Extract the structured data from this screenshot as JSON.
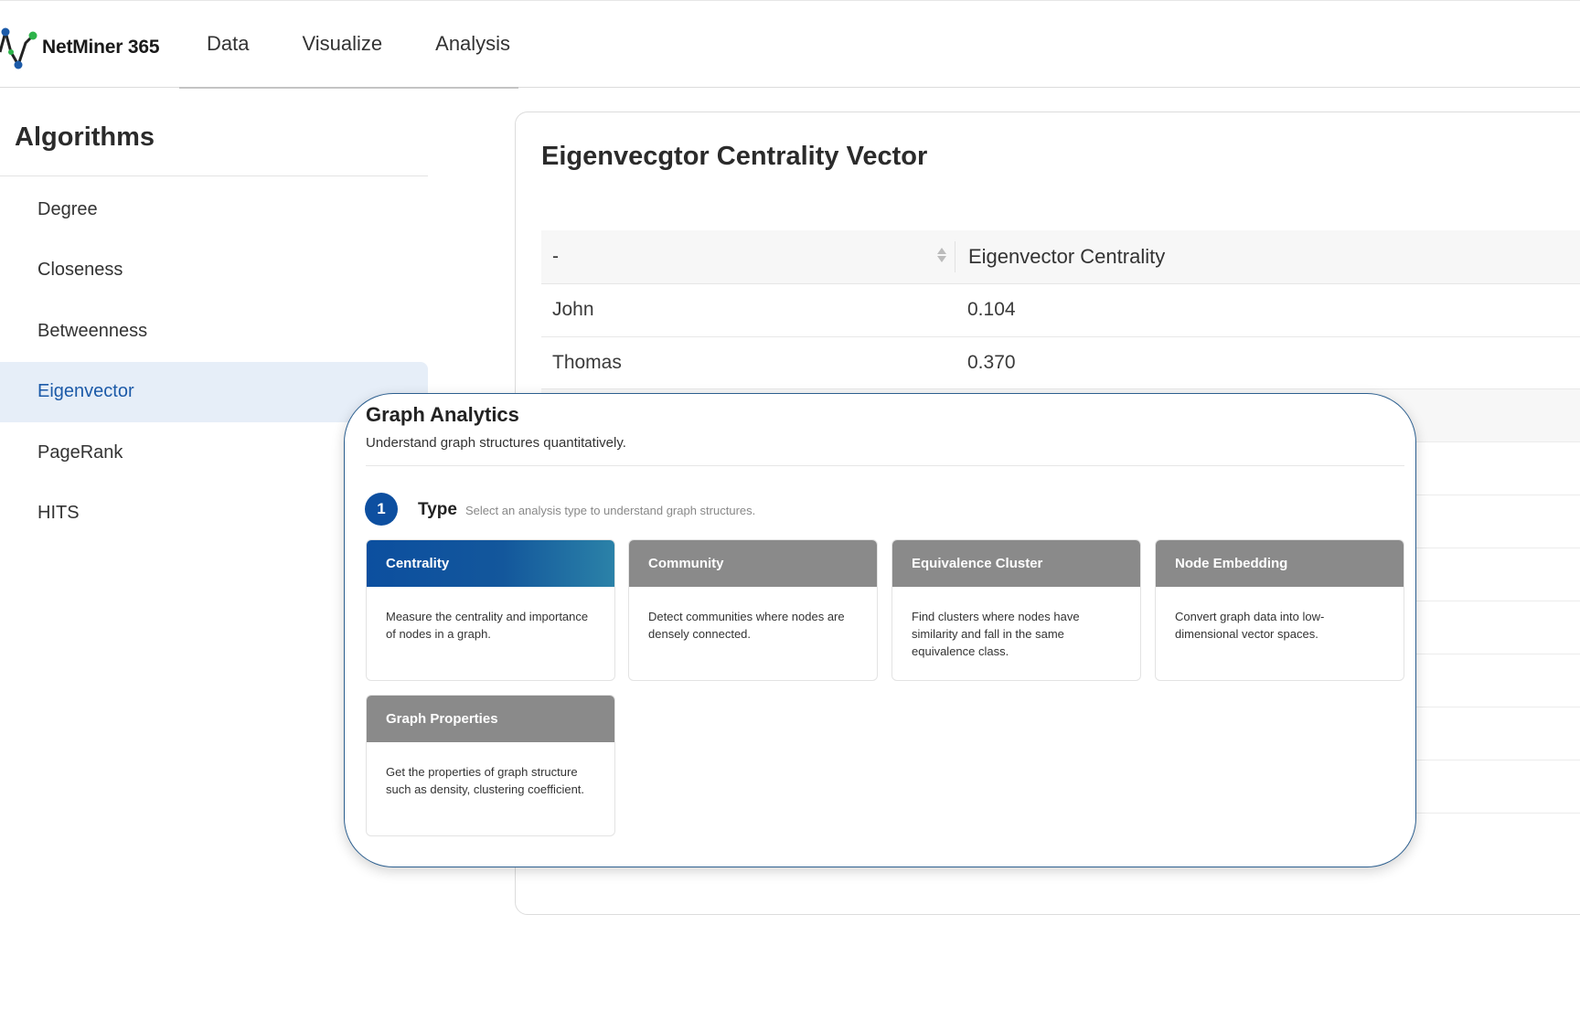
{
  "app": {
    "name": "NetMiner 365",
    "brand_colors": {
      "blue": "#1c5aa8",
      "green": "#2db34a",
      "dark": "#222222"
    }
  },
  "nav": {
    "tabs": [
      {
        "label": "Data"
      },
      {
        "label": "Visualize"
      },
      {
        "label": "Analysis"
      }
    ]
  },
  "sidebar": {
    "title": "Algorithms",
    "items": [
      {
        "label": "Degree",
        "active": false
      },
      {
        "label": "Closeness",
        "active": false
      },
      {
        "label": "Betweenness",
        "active": false
      },
      {
        "label": "Eigenvector",
        "active": true
      },
      {
        "label": "PageRank",
        "active": false
      },
      {
        "label": "HITS",
        "active": false
      }
    ]
  },
  "result": {
    "title": "Eigenvecgtor Centrality Vector",
    "columns": [
      "-",
      "Eigenvector Centrality"
    ],
    "rows": [
      {
        "name": "John",
        "value": "0.104"
      },
      {
        "name": "Thomas",
        "value": "0.370"
      }
    ]
  },
  "overlay": {
    "title": "Graph Analytics",
    "subtitle": "Understand graph structures quantitatively.",
    "step": {
      "number": "1",
      "label": "Type",
      "description": "Select an analysis type to understand graph structures."
    },
    "cards": [
      {
        "title": "Centrality",
        "body": "Measure the centrality and importance of nodes in a graph.",
        "selected": true
      },
      {
        "title": "Community",
        "body": "Detect communities where nodes are densely connected.",
        "selected": false
      },
      {
        "title": "Equivalence Cluster",
        "body": "Find clusters where nodes have similarity and fall in the same equivalence class.",
        "selected": false
      },
      {
        "title": "Node Embedding",
        "body": "Convert graph data into low-dimensional vector spaces.",
        "selected": false
      },
      {
        "title": "Graph Properties",
        "body": "Get the properties of graph structure such as density, clustering coefficient.",
        "selected": false
      }
    ]
  }
}
